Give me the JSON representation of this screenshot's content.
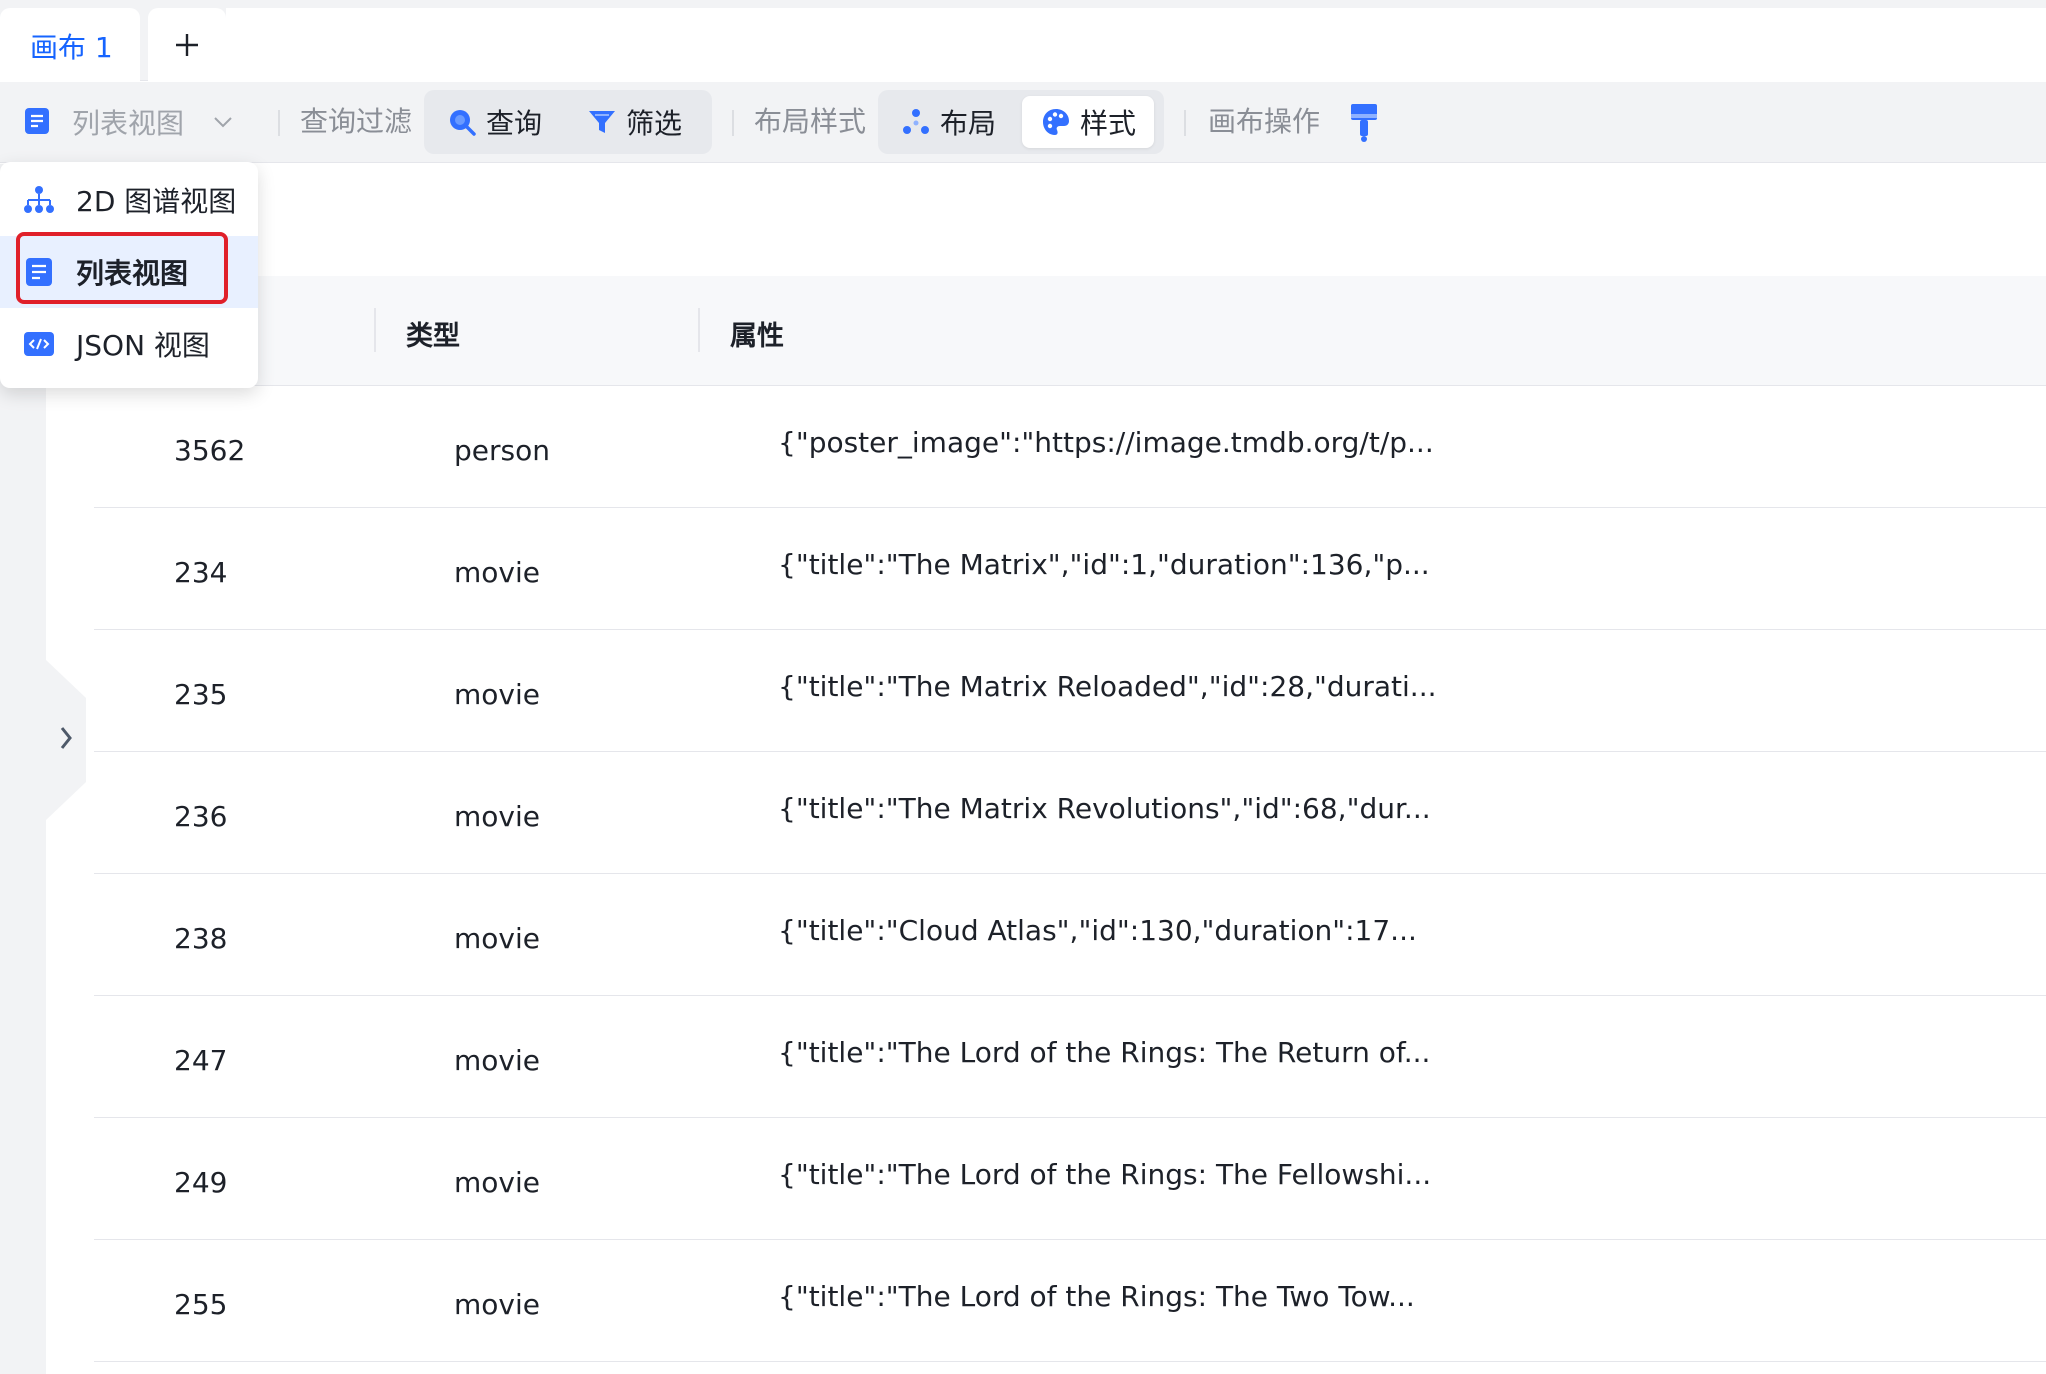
{
  "tabs": {
    "active_label": "画布 1",
    "add_label": "+"
  },
  "toolbar": {
    "view_label": "列表视图",
    "query_filter_label": "查询过滤",
    "query_label": "查询",
    "filter_label": "筛选",
    "layout_style_label": "布局样式",
    "layout_label": "布局",
    "style_label": "样式",
    "canvas_ops_label": "画布操作"
  },
  "view_menu": {
    "items": [
      {
        "label": "2D 图谱视图",
        "icon": "graph-tree-icon"
      },
      {
        "label": "列表视图",
        "icon": "list-view-icon",
        "selected": true
      },
      {
        "label": "JSON 视图",
        "icon": "json-code-icon"
      }
    ]
  },
  "table": {
    "columns": [
      "类型",
      "属性"
    ],
    "rows": [
      {
        "id": "3562",
        "type": "person",
        "props": "{\"poster_image\":\"https://image.tmdb.org/t/p..."
      },
      {
        "id": "234",
        "type": "movie",
        "props": "{\"title\":\"The Matrix\",\"id\":1,\"duration\":136,\"p..."
      },
      {
        "id": "235",
        "type": "movie",
        "props": "{\"title\":\"The Matrix Reloaded\",\"id\":28,\"durati..."
      },
      {
        "id": "236",
        "type": "movie",
        "props": "{\"title\":\"The Matrix Revolutions\",\"id\":68,\"dur..."
      },
      {
        "id": "238",
        "type": "movie",
        "props": "{\"title\":\"Cloud Atlas\",\"id\":130,\"duration\":17..."
      },
      {
        "id": "247",
        "type": "movie",
        "props": "{\"title\":\"The Lord of the Rings: The Return of..."
      },
      {
        "id": "249",
        "type": "movie",
        "props": "{\"title\":\"The Lord of the Rings: The Fellowshi..."
      },
      {
        "id": "255",
        "type": "movie",
        "props": "{\"title\":\"The Lord of the Rings: The Two Tow..."
      }
    ]
  },
  "colors": {
    "accent": "#1664ff",
    "highlight": "#e0202a"
  }
}
